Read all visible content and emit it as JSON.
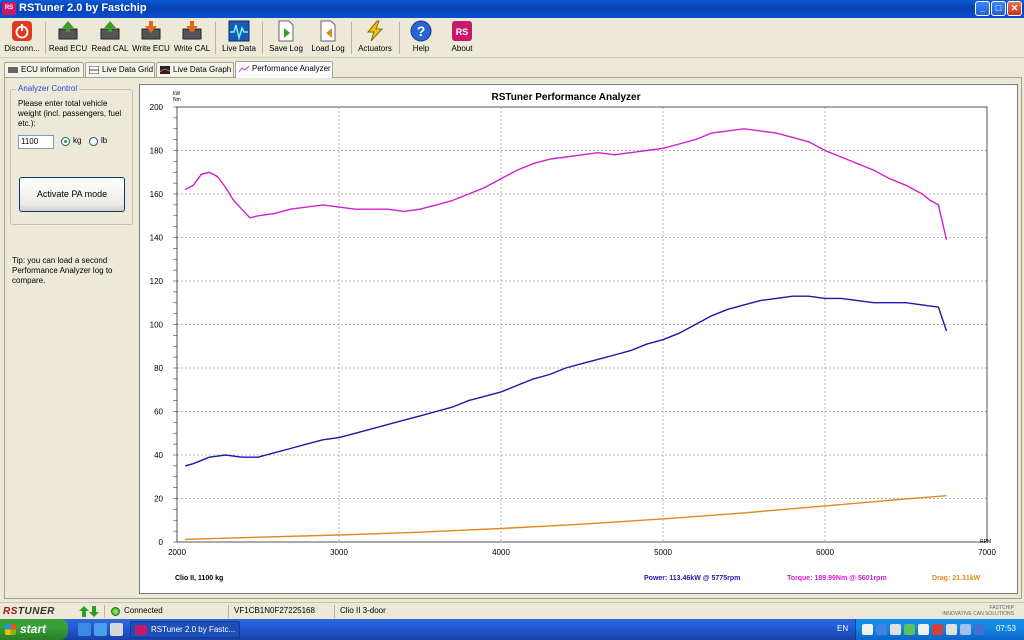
{
  "window": {
    "title": "RSTuner 2.0 by Fastchip",
    "app_icon_text": "RS",
    "minimize": "_",
    "maximize": "□",
    "close": "✕"
  },
  "toolbar": {
    "items": [
      {
        "label": "Disconn...",
        "icon": "power-icon",
        "color": "#e03a1e"
      },
      {
        "label": "Read ECU",
        "icon": "read-ecu-icon",
        "color": "#3a9a2a"
      },
      {
        "label": "Read CAL",
        "icon": "read-cal-icon",
        "color": "#3a9a2a"
      },
      {
        "label": "Write ECU",
        "icon": "write-ecu-icon",
        "color": "#e06a1e"
      },
      {
        "label": "Write CAL",
        "icon": "write-cal-icon",
        "color": "#e06a1e"
      },
      {
        "label": "Live Data",
        "icon": "live-data-icon",
        "color": "#1a5ab0"
      },
      {
        "label": "Save Log",
        "icon": "save-log-icon",
        "color": "#3a9a2a"
      },
      {
        "label": "Load Log",
        "icon": "load-log-icon",
        "color": "#e08a1e"
      },
      {
        "label": "Actuators",
        "icon": "lightning-icon",
        "color": "#e8c81a"
      },
      {
        "label": "Help",
        "icon": "help-icon",
        "color": "#2a64d0"
      },
      {
        "label": "About",
        "icon": "about-icon",
        "color": "#c8186a"
      }
    ],
    "about_icon_text": "RS"
  },
  "tabs": [
    {
      "label": "ECU information",
      "icon": "ecu-info-icon"
    },
    {
      "label": "Live Data Grid",
      "icon": "grid-icon"
    },
    {
      "label": "Live Data Graph",
      "icon": "graph-icon"
    },
    {
      "label": "Performance Analyzer",
      "icon": "analyzer-icon",
      "active": true
    }
  ],
  "analyzer": {
    "group_title": "Analyzer Control",
    "instructions": "Please enter total vehicle weight (incl. passengers, fuel etc.):",
    "weight_value": "1100",
    "unit_kg": "kg",
    "unit_lb": "lb",
    "selected_unit": "kg",
    "button_label": "Activate PA mode",
    "tip": "Tip: you can load a second Performance Analyzer log to compare."
  },
  "chart_data": {
    "type": "line",
    "title": "RSTuner Performance Analyzer",
    "y_unit_label": "kW\nNm",
    "x_unit_label": "RPM",
    "xlim": [
      2000,
      7000
    ],
    "ylim": [
      0,
      200
    ],
    "x_ticks": [
      2000,
      3000,
      4000,
      5000,
      6000,
      7000
    ],
    "y_ticks": [
      0,
      20,
      40,
      60,
      80,
      100,
      120,
      140,
      160,
      180,
      200
    ],
    "grid": true,
    "series": [
      {
        "name": "Torque",
        "color": "#d020d0",
        "x": [
          2050,
          2100,
          2150,
          2200,
          2250,
          2300,
          2350,
          2400,
          2450,
          2500,
          2600,
          2700,
          2800,
          2900,
          3000,
          3100,
          3200,
          3300,
          3400,
          3500,
          3600,
          3700,
          3800,
          3900,
          4000,
          4100,
          4200,
          4300,
          4400,
          4500,
          4600,
          4700,
          4800,
          4900,
          5000,
          5100,
          5200,
          5300,
          5400,
          5500,
          5600,
          5700,
          5800,
          5900,
          6000,
          6100,
          6200,
          6300,
          6400,
          6500,
          6600,
          6650,
          6700,
          6750
        ],
        "y": [
          162,
          164,
          169,
          170,
          168,
          163,
          157,
          153,
          149,
          150,
          151,
          153,
          154,
          155,
          154,
          153,
          153,
          153,
          152,
          153,
          155,
          157,
          160,
          163,
          167,
          171,
          174,
          176,
          177,
          178,
          179,
          178,
          179,
          180,
          181,
          183,
          185,
          188,
          189,
          190,
          189,
          188,
          186,
          184,
          180,
          177,
          174,
          171,
          167,
          164,
          160,
          157,
          155,
          139
        ]
      },
      {
        "name": "Power",
        "color": "#1a1aa8",
        "x": [
          2050,
          2100,
          2200,
          2300,
          2400,
          2500,
          2600,
          2700,
          2800,
          2900,
          3000,
          3100,
          3200,
          3300,
          3400,
          3500,
          3600,
          3700,
          3800,
          3900,
          4000,
          4100,
          4200,
          4300,
          4400,
          4500,
          4600,
          4700,
          4800,
          4900,
          5000,
          5100,
          5200,
          5300,
          5400,
          5500,
          5600,
          5700,
          5800,
          5900,
          6000,
          6100,
          6200,
          6300,
          6400,
          6500,
          6600,
          6700,
          6750
        ],
        "y": [
          35,
          36,
          39,
          40,
          39,
          39,
          41,
          43,
          45,
          47,
          48,
          50,
          52,
          54,
          56,
          58,
          60,
          62,
          65,
          67,
          69,
          72,
          75,
          77,
          80,
          82,
          84,
          86,
          88,
          91,
          93,
          96,
          100,
          104,
          107,
          109,
          111,
          112,
          113,
          113,
          112,
          112,
          111,
          110,
          110,
          110,
          109,
          108,
          97
        ]
      },
      {
        "name": "Drag",
        "color": "#e08a1e",
        "x": [
          2050,
          2500,
          3000,
          3500,
          4000,
          4500,
          5000,
          5500,
          6000,
          6500,
          6750
        ],
        "y": [
          1.2,
          2.2,
          3.2,
          4.5,
          6.2,
          8.2,
          10.6,
          13.4,
          16.6,
          19.8,
          21.3
        ]
      }
    ],
    "footer": {
      "vehicle": "Clio II, 1100 kg",
      "power": "Power: 113.46kW @ 5775rpm",
      "torque": "Torque: 189.99Nm @ 5601rpm",
      "drag": "Drag: 21.31kW"
    }
  },
  "statusbar": {
    "logo_rs": "RS",
    "logo_tuner": "TUNER",
    "connection": "Connected",
    "vin": "VF1CB1N0F27225168",
    "vehicle": "Clio II 3-door",
    "brand_line1": "FASTCHIP",
    "brand_line2": "INNOVATIVE CAN SOLUTIONS"
  },
  "taskbar": {
    "start": "start",
    "task_item": "RSTuner 2.0 by Fastc...",
    "language": "EN",
    "clock": "07:53"
  }
}
